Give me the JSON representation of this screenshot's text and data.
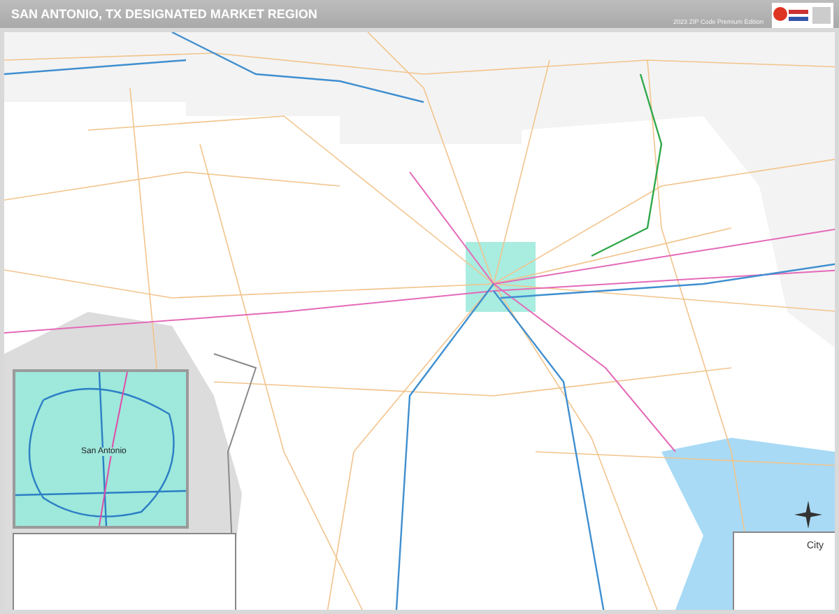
{
  "header": {
    "title": "SAN ANTONIO, TX DESIGNATED MARKET REGION",
    "edition": "2023 ZIP Code Premium Edition"
  },
  "inset": {
    "label": "San Antonio"
  },
  "legend": {
    "city_label": "City"
  }
}
